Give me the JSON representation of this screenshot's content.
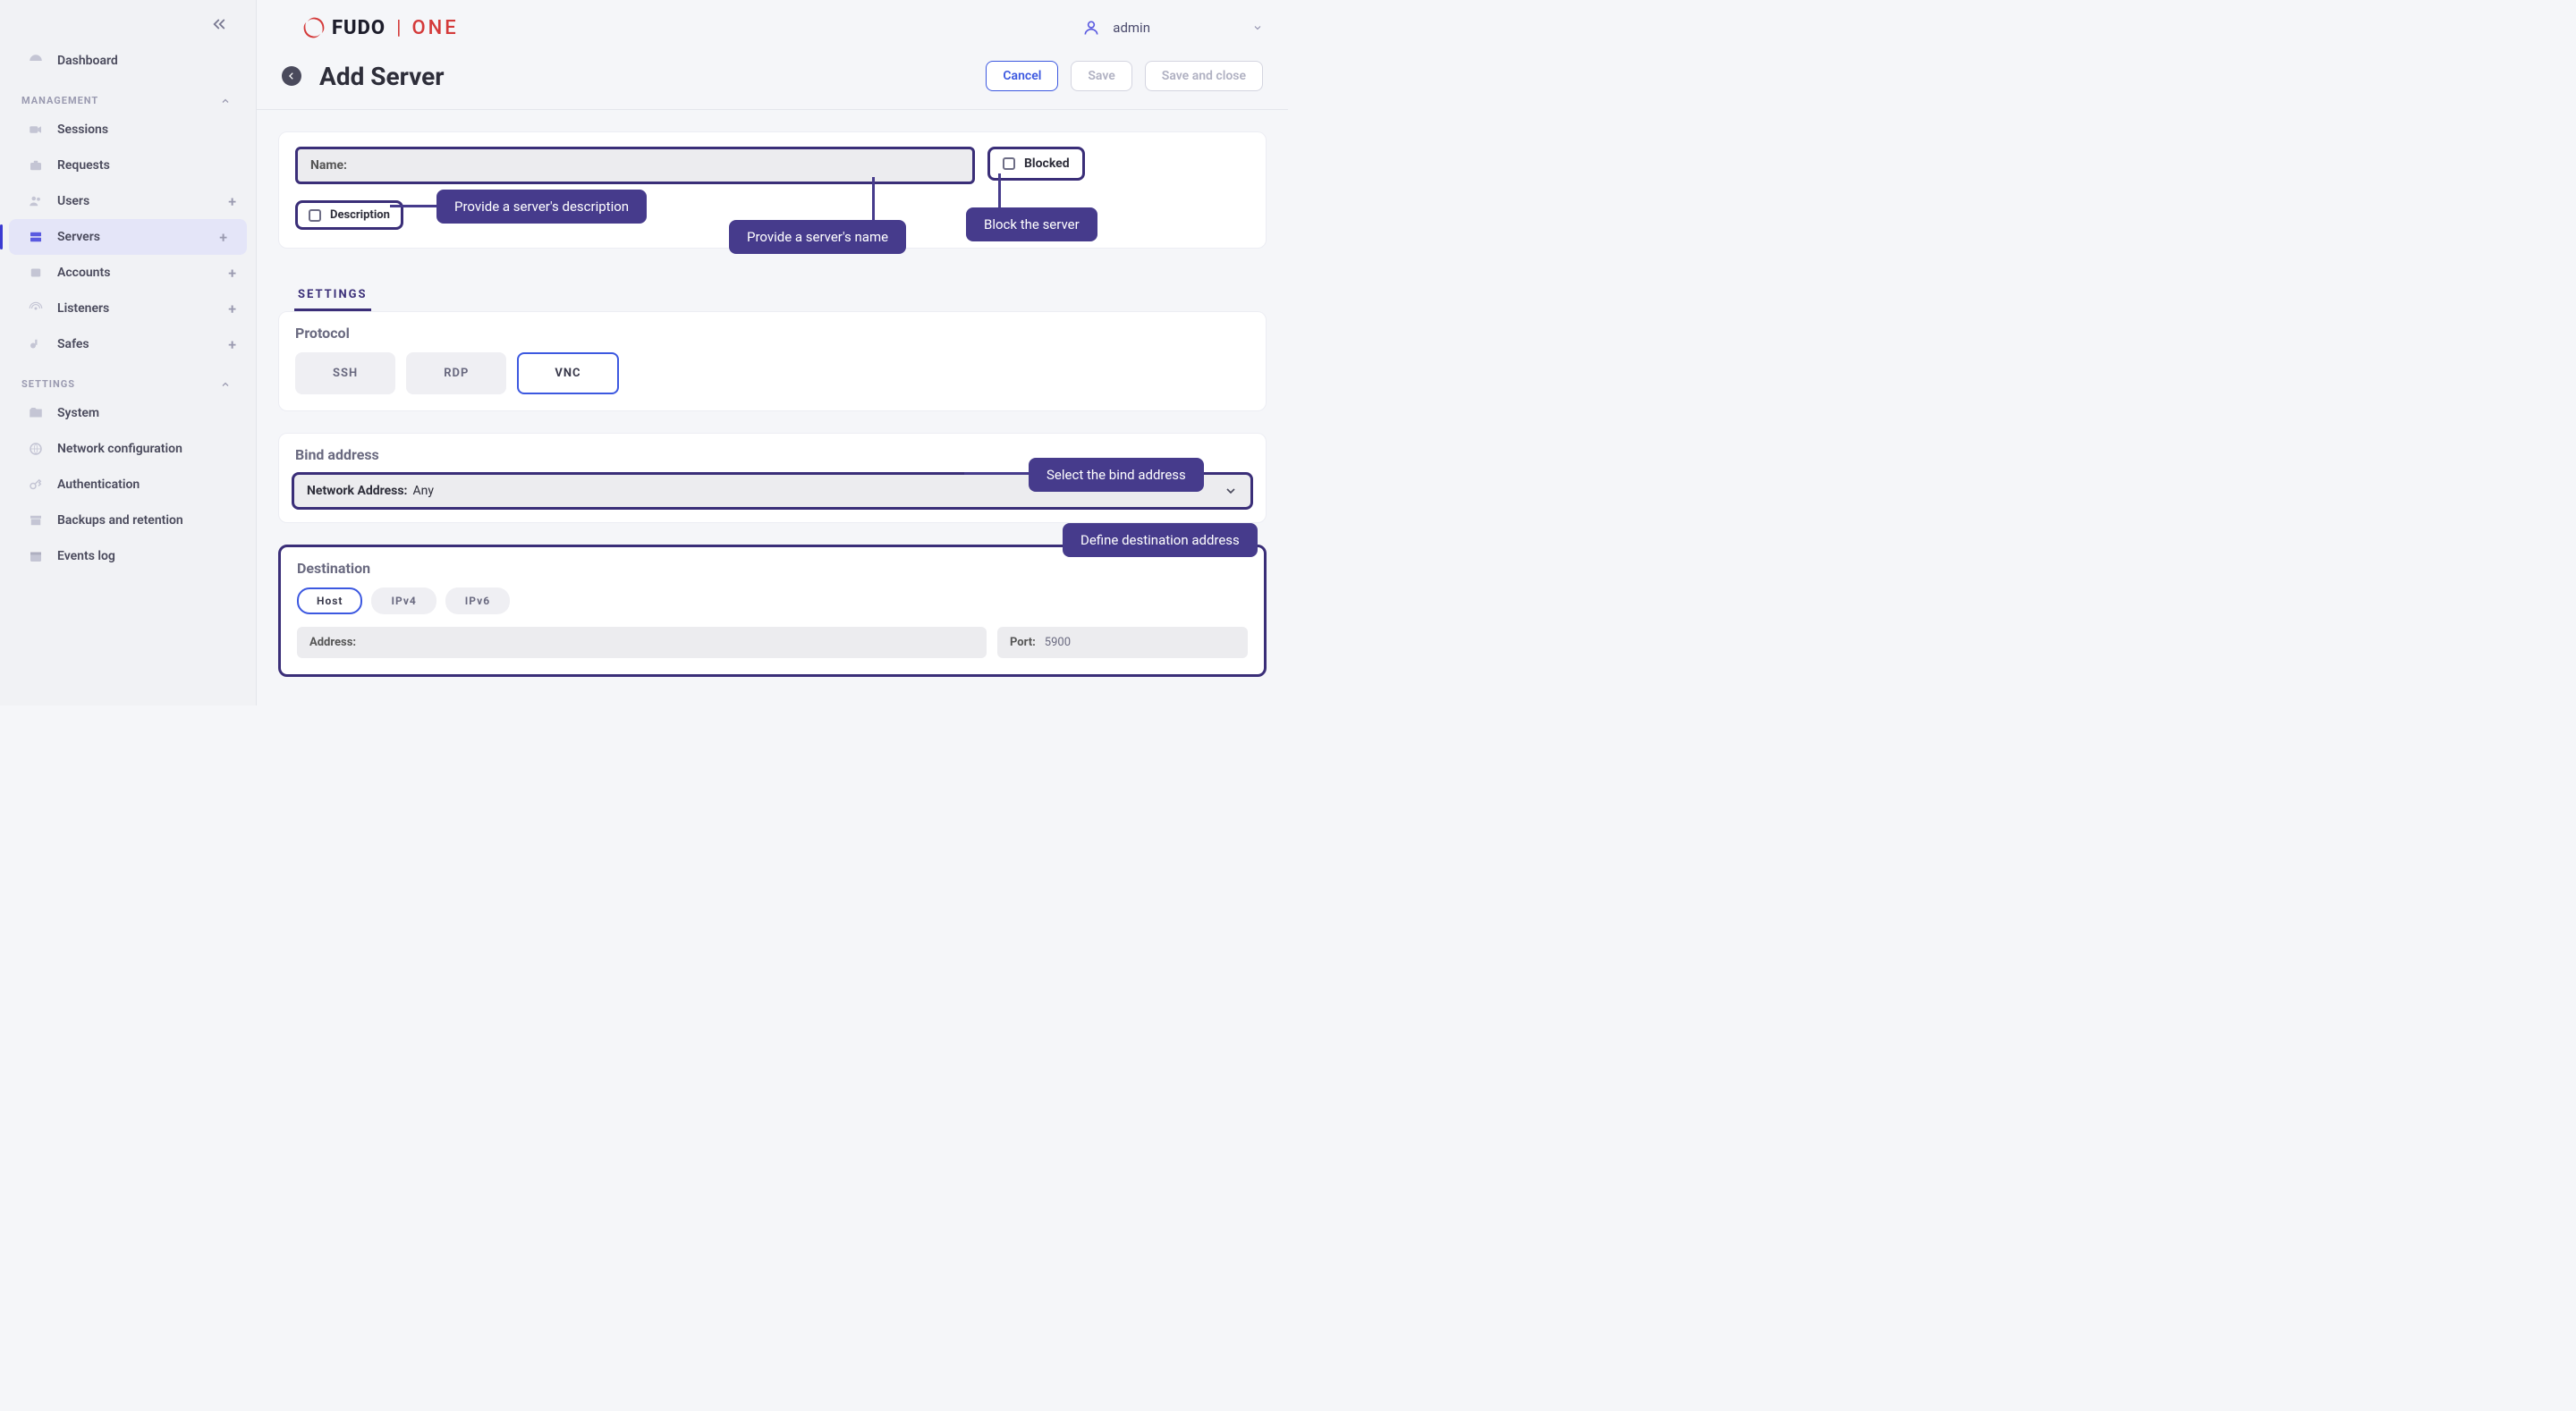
{
  "brand": {
    "name1": "FUDO",
    "name2": "ONE"
  },
  "user": {
    "name": "admin"
  },
  "sidebar": {
    "dashboard": "Dashboard",
    "sections": {
      "management": "MANAGEMENT",
      "settings": "SETTINGS"
    },
    "items": {
      "sessions": "Sessions",
      "requests": "Requests",
      "users": "Users",
      "servers": "Servers",
      "accounts": "Accounts",
      "listeners": "Listeners",
      "safes": "Safes",
      "system": "System",
      "network": "Network configuration",
      "auth": "Authentication",
      "backups": "Backups and retention",
      "events": "Events log"
    }
  },
  "page": {
    "title": "Add Server",
    "buttons": {
      "cancel": "Cancel",
      "save": "Save",
      "save_close": "Save and close"
    }
  },
  "form": {
    "name_label": "Name:",
    "blocked_label": "Blocked",
    "description_label": "Description",
    "settings_tab": "SETTINGS",
    "protocol": {
      "title": "Protocol",
      "options": [
        "SSH",
        "RDP",
        "VNC"
      ],
      "selected": "VNC"
    },
    "bind": {
      "title": "Bind address",
      "label": "Network Address:",
      "value": "Any"
    },
    "dest": {
      "title": "Destination",
      "tabs": [
        "Host",
        "IPv4",
        "IPv6"
      ],
      "selected": "Host",
      "address_label": "Address:",
      "port_label": "Port:",
      "port_value": "5900"
    }
  },
  "callouts": {
    "name": "Provide a server's name",
    "desc": "Provide a server's description",
    "block": "Block the server",
    "bind": "Select the bind address",
    "dest": "Define destination address"
  }
}
